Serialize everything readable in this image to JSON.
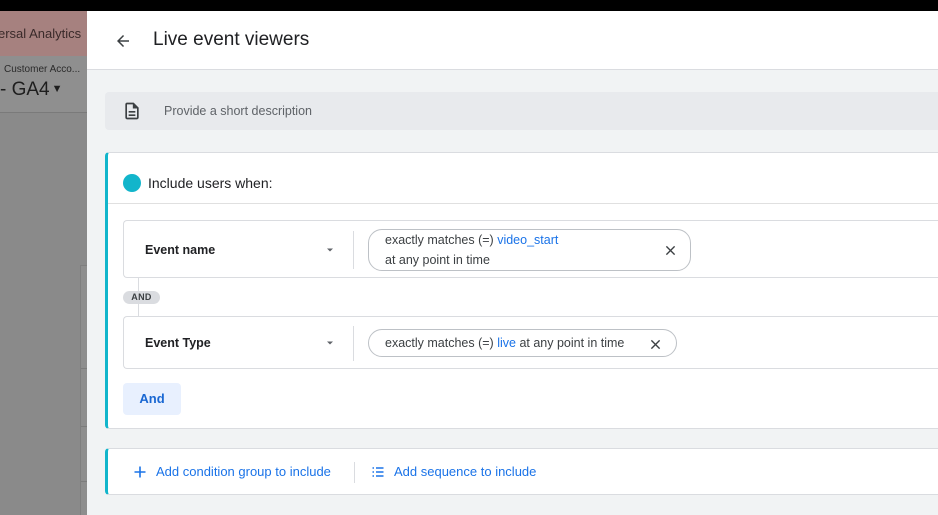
{
  "background_app": {
    "brand_text": "ersal Analytics",
    "account_text": "Customer Acco...",
    "property_text": "- GA4"
  },
  "panel": {
    "title": "Live event viewers",
    "description_placeholder": "Provide a short description"
  },
  "include_group": {
    "label": "Include users when:",
    "conditions": [
      {
        "dimension": "Event name",
        "operator": "exactly matches (=)",
        "value": "video_start",
        "timing": "at any point in time"
      },
      {
        "dimension": "Event Type",
        "operator": "exactly matches (=)",
        "value": "live",
        "timing": "at any point in time"
      }
    ],
    "connector": "AND",
    "and_button": "And"
  },
  "add_actions": {
    "condition_group": "Add condition group to include",
    "sequence": "Add sequence to include"
  },
  "colors": {
    "accent_teal": "#12b5cb",
    "link_blue": "#1a73e8",
    "brand_bg": "#a6817f"
  }
}
